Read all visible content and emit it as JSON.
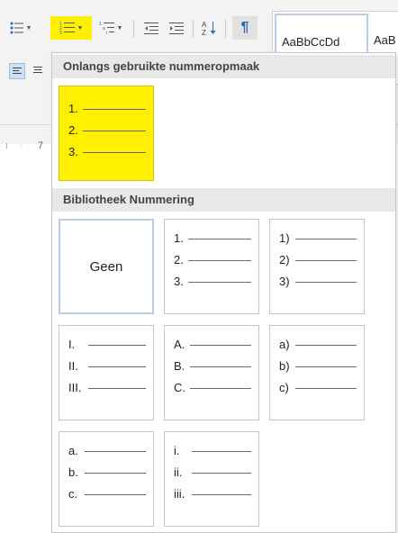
{
  "ribbon": {
    "buttons": [
      {
        "name": "bullets-button",
        "icon": "bulleted-list-icon",
        "glyph": "☰"
      },
      {
        "name": "numbering-button",
        "icon": "numbered-list-icon",
        "glyph": "☰"
      },
      {
        "name": "multilevel-list-button",
        "icon": "multilevel-list-icon",
        "glyph": "☰"
      },
      {
        "name": "decrease-indent-button",
        "icon": "decrease-indent-icon",
        "glyph": "⇤"
      },
      {
        "name": "increase-indent-button",
        "icon": "increase-indent-icon",
        "glyph": "⇥"
      },
      {
        "name": "sort-button",
        "icon": "sort-az-icon",
        "glyph": "A↓"
      },
      {
        "name": "show-marks-button",
        "icon": "pilcrow-icon",
        "glyph": "¶"
      }
    ],
    "styles": {
      "normal": "AaBbCcDd",
      "next": "AaB"
    },
    "ruler": {
      "mark": "7"
    },
    "colors": {
      "highlight": "#fff000",
      "selected_border": "#b8cdea"
    }
  },
  "dropdown": {
    "recent_header": "Onlangs gebruikte nummeropmaak",
    "recent_tile": {
      "markers": [
        "1.",
        "2.",
        "3."
      ]
    },
    "library_header": "Bibliotheek Nummering",
    "none_label": "Geen",
    "library_tiles": [
      {
        "name": "numbering-format-123-dot",
        "markers": [
          "1.",
          "2.",
          "3."
        ]
      },
      {
        "name": "numbering-format-123-paren",
        "markers": [
          "1)",
          "2)",
          "3)"
        ]
      },
      {
        "name": "numbering-format-roman-upper",
        "markers": [
          "I.",
          "II.",
          "III."
        ]
      },
      {
        "name": "numbering-format-alpha-upper",
        "markers": [
          "A.",
          "B.",
          "C."
        ]
      },
      {
        "name": "numbering-format-alpha-lower-paren",
        "markers": [
          "a)",
          "b)",
          "c)"
        ]
      },
      {
        "name": "numbering-format-alpha-lower-dot",
        "markers": [
          "a.",
          "b.",
          "c."
        ]
      },
      {
        "name": "numbering-format-roman-lower",
        "markers": [
          "i.",
          "ii.",
          "iii."
        ]
      }
    ]
  }
}
